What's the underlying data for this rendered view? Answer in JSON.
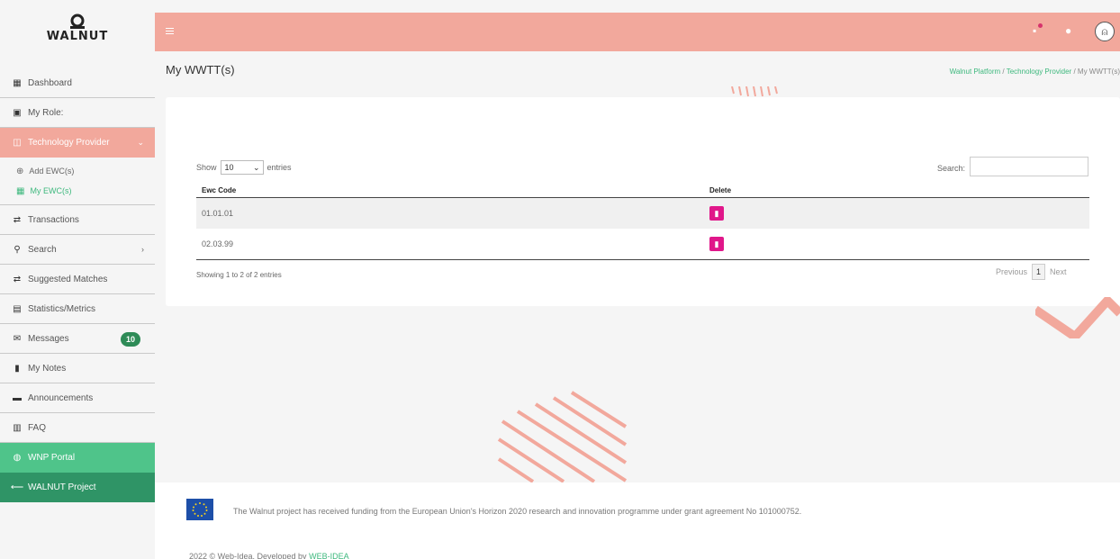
{
  "brand": {
    "name": "WALNUT"
  },
  "sidebar": {
    "items": [
      {
        "label": "Dashboard",
        "icon": "dashboard-icon"
      },
      {
        "label": "My Role:",
        "icon": "briefcase-icon"
      },
      {
        "label": "Technology Provider",
        "icon": "building-icon"
      },
      {
        "label": "Transactions",
        "icon": "arrows-icon"
      },
      {
        "label": "Search",
        "icon": "search-icon"
      },
      {
        "label": "Suggested Matches",
        "icon": "arrows-icon"
      },
      {
        "label": "Statistics/Metrics",
        "icon": "chart-icon"
      },
      {
        "label": "Messages",
        "icon": "envelope-icon",
        "badge": "10"
      },
      {
        "label": "My Notes",
        "icon": "bookmark-icon"
      },
      {
        "label": "Announcements",
        "icon": "comment-icon"
      },
      {
        "label": "FAQ",
        "icon": "book-icon"
      },
      {
        "label": "WNP Portal",
        "icon": "globe-icon"
      },
      {
        "label": "WALNUT Project",
        "icon": "arrow-left-icon"
      }
    ],
    "sub_items": [
      {
        "label": "Add EWC(s)",
        "icon": "plus-circle-icon"
      },
      {
        "label": "My EWC(s)",
        "icon": "table-icon"
      }
    ]
  },
  "header": {
    "page_title": "My WWTT(s)",
    "breadcrumb": [
      "Walnut Platform",
      "Technology Provider",
      "My WWTT(s)"
    ],
    "breadcrumb_sep": "/"
  },
  "table": {
    "show_label": "Show",
    "entries_label": "entries",
    "page_length": "10",
    "search_label": "Search:",
    "search_value": "",
    "columns": [
      "Ewc Code",
      "Delete"
    ],
    "rows": [
      {
        "code": "01.01.01"
      },
      {
        "code": "02.03.99"
      }
    ],
    "info": "Showing 1 to 2 of 2 entries",
    "pager": {
      "previous": "Previous",
      "current": "1",
      "next": "Next"
    }
  },
  "footer": {
    "funding": "The Walnut project has received funding from the European Union's Horizon 2020 research and innovation programme under grant agreement No 101000752.",
    "copyright_prefix": "2022 © Web-Idea. Developed by",
    "copyright_link": "WEB-IDEA"
  },
  "colors": {
    "accent": "#f2a89c",
    "green": "#4fc48a",
    "dark_green": "#2f9466",
    "delete": "#e0178a"
  }
}
